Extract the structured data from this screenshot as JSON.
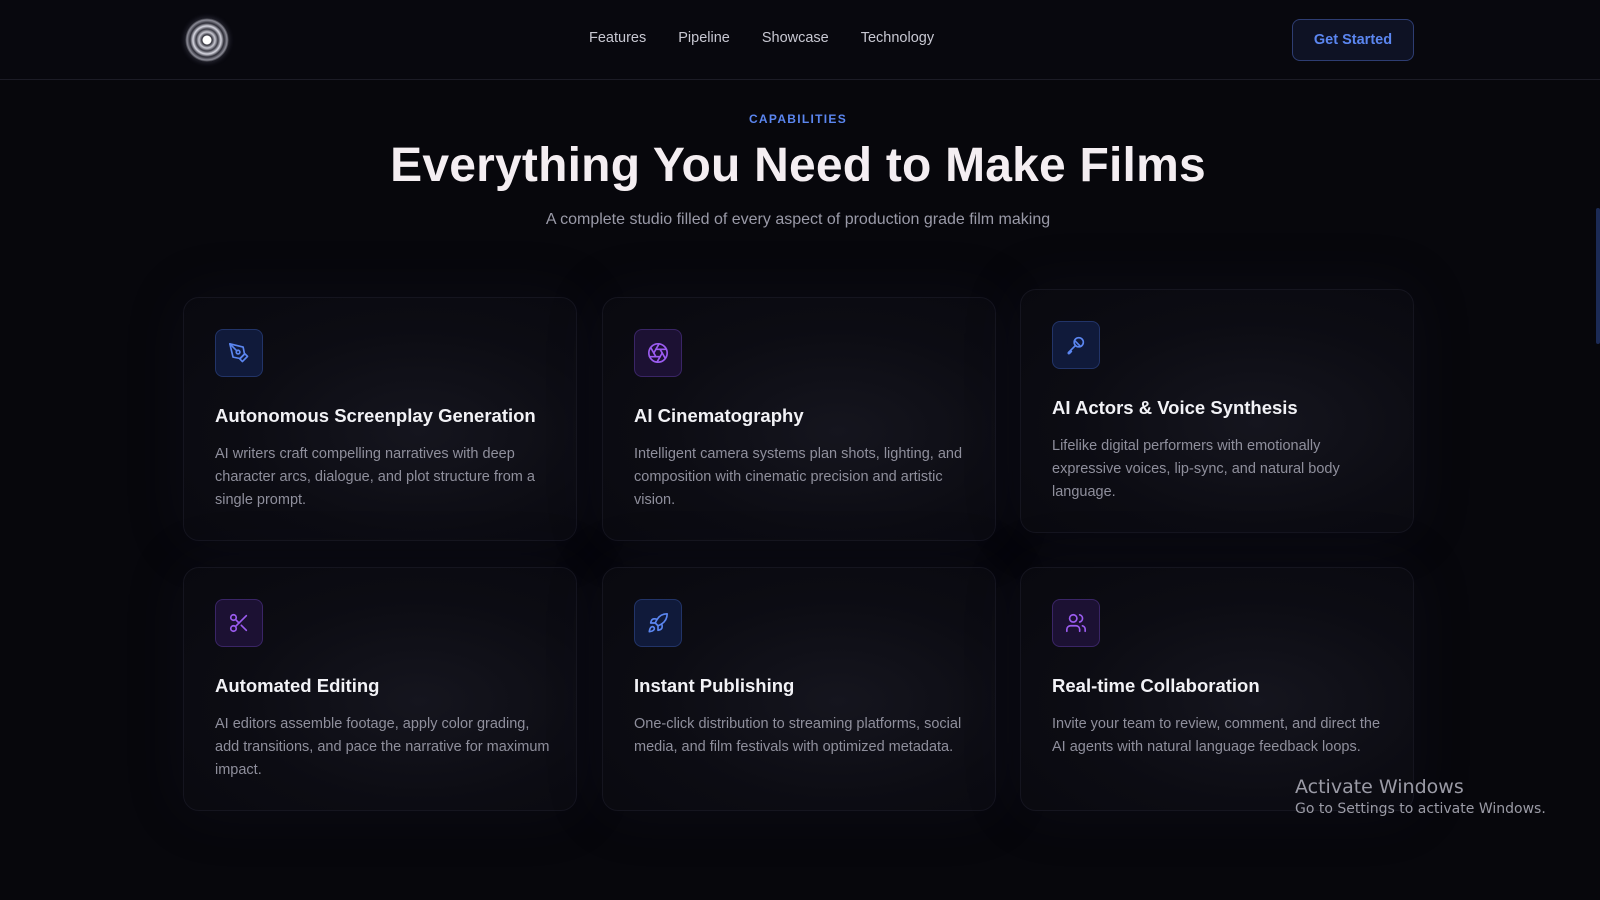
{
  "nav": {
    "logo_icon": "spiral-logo-icon",
    "links": [
      "Features",
      "Pipeline",
      "Showcase",
      "Technology"
    ],
    "cta_label": "Get Started"
  },
  "section": {
    "eyebrow": "CAPABILITIES",
    "title": "Everything You Need to Make Films",
    "subtitle": "A complete studio filled of every aspect of production grade film making"
  },
  "cards": [
    {
      "icon": "pen-tool-icon",
      "accent": "#5b86f0",
      "title": "Autonomous Screenplay Generation",
      "description": "AI writers craft compelling narratives with deep character arcs, dialogue, and plot structure from a single prompt."
    },
    {
      "icon": "aperture-icon",
      "accent": "#9b5cf0",
      "title": "AI Cinematography",
      "description": "Intelligent camera systems plan shots, lighting, and composition with cinematic precision and artistic vision."
    },
    {
      "icon": "microphone-icon",
      "accent": "#5b86f0",
      "title": "AI Actors & Voice Synthesis",
      "description": "Lifelike digital performers with emotionally expressive voices, lip-sync, and natural body language."
    },
    {
      "icon": "scissors-icon",
      "accent": "#9b5cf0",
      "title": "Automated Editing",
      "description": "AI editors assemble footage, apply color grading, add transitions, and pace the narrative for maximum impact."
    },
    {
      "icon": "rocket-icon",
      "accent": "#5b86f0",
      "title": "Instant Publishing",
      "description": "One-click distribution to streaming platforms, social media, and film festivals with optimized metadata."
    },
    {
      "icon": "users-icon",
      "accent": "#9b5cf0",
      "title": "Real-time Collaboration",
      "description": "Invite your team to review, comment, and direct the AI agents with natural language feedback loops."
    }
  ],
  "watermark": {
    "line1": "Activate Windows",
    "line2": "Go to Settings to activate Windows."
  }
}
